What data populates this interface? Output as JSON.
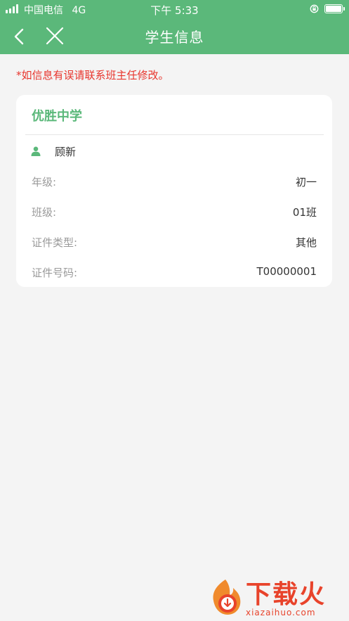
{
  "status_bar": {
    "carrier": "中国电信",
    "network": "4G",
    "time": "下午 5:33"
  },
  "nav": {
    "title": "学生信息",
    "back_icon": "chevron-left-icon",
    "close_icon": "close-icon"
  },
  "notice": "*如信息有误请联系班主任修改。",
  "card": {
    "school": "优胜中学",
    "student_name": "顾新",
    "person_icon": "person-icon",
    "rows": [
      {
        "label": "年级:",
        "value": "初一"
      },
      {
        "label": "班级:",
        "value": "01班"
      },
      {
        "label": "证件类型:",
        "value": "其他"
      },
      {
        "label": "证件号码:",
        "value": "T00000001"
      }
    ]
  },
  "watermark": {
    "logo_text": "下载火",
    "url": "xiazaihuo.com"
  },
  "colors": {
    "primary": "#5bb87a",
    "notice": "#e8352d",
    "background": "#f4f4f4"
  }
}
